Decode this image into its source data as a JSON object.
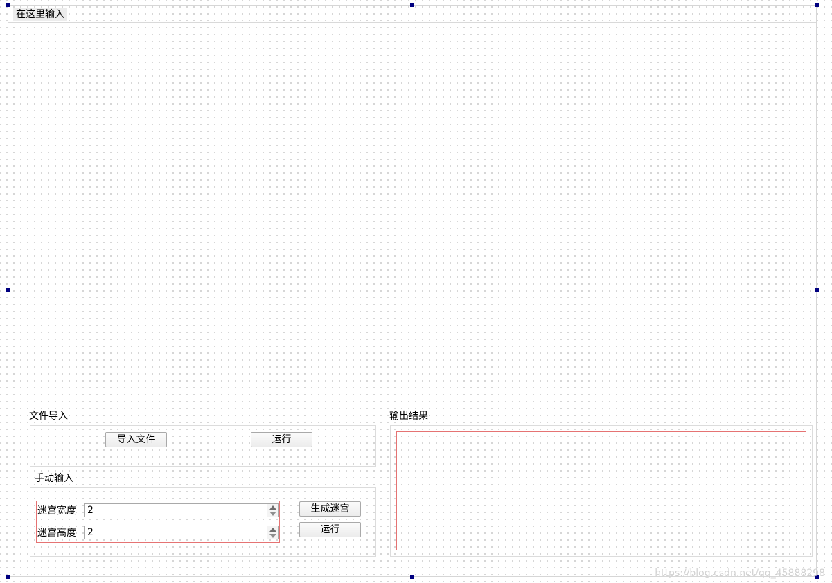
{
  "menubar": {
    "placeholder_item": "在这里输入"
  },
  "file_import": {
    "title": "文件导入",
    "import_button": "导入文件",
    "run_button": "运行"
  },
  "manual_input": {
    "title": "手动输入",
    "width_label": "迷宫宽度",
    "width_value": "2",
    "height_label": "迷宫高度",
    "height_value": "2",
    "generate_button": "生成迷宫",
    "run_button": "运行"
  },
  "output": {
    "title": "输出结果"
  },
  "watermark": "https://blog.csdn.net/qq_45888298",
  "colors": {
    "selection_handle": "#000080",
    "layout_outline": "#e57373"
  }
}
